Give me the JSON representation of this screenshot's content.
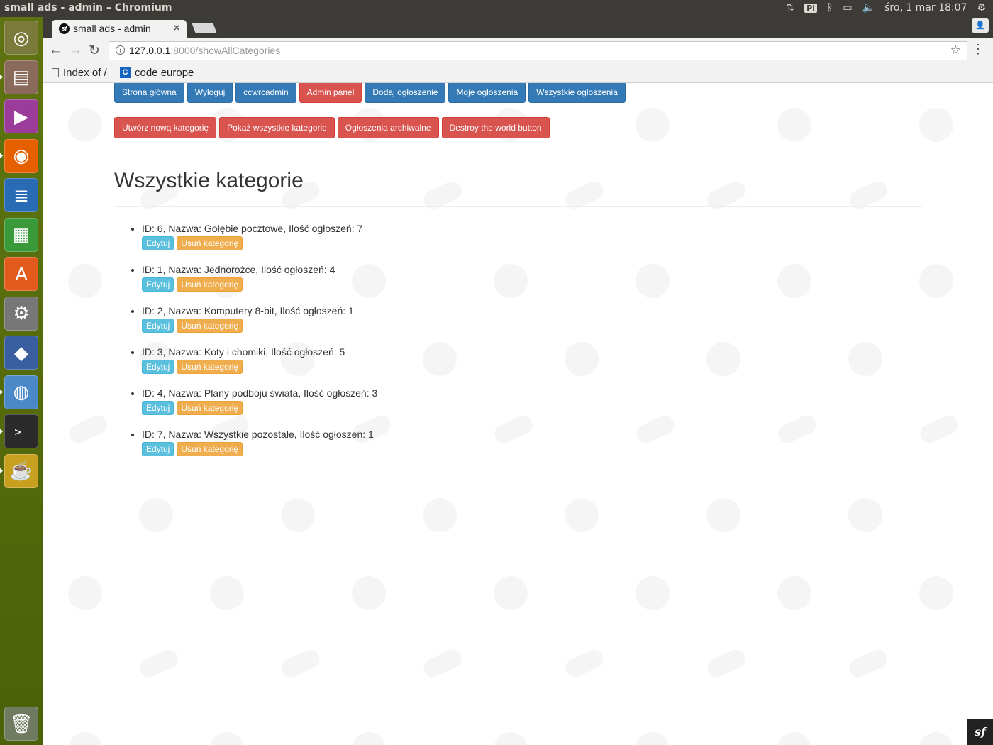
{
  "os": {
    "window_title": "small ads - admin – Chromium",
    "keyboard_layout": "Pl",
    "datetime": "śro, 1 mar 18:07"
  },
  "browser": {
    "tab_title": "small ads - admin",
    "url_host": "127.0.0.1",
    "url_path": ":8000/showAllCategories",
    "bookmarks": [
      {
        "label": "Index of /",
        "icon": "document-icon"
      },
      {
        "label": "code europe",
        "icon": "c-logo-icon"
      }
    ]
  },
  "nav": {
    "main": [
      {
        "label": "Strona główna",
        "style": "primary"
      },
      {
        "label": "Wyloguj",
        "style": "primary"
      },
      {
        "label": "ccwrcadmin",
        "style": "primary"
      },
      {
        "label": "Admin panel",
        "style": "danger"
      },
      {
        "label": "Dodaj ogłoszenie",
        "style": "primary"
      },
      {
        "label": "Moje ogłoszenia",
        "style": "primary"
      },
      {
        "label": "Wszystkie ogłoszenia",
        "style": "primary"
      }
    ],
    "admin": [
      {
        "label": "Utwórz nową kategorię",
        "style": "danger"
      },
      {
        "label": "Pokaż wszystkie kategorie",
        "style": "danger"
      },
      {
        "label": "Ogłoszenia archiwalne",
        "style": "danger"
      },
      {
        "label": "Destroy the world button",
        "style": "danger"
      }
    ]
  },
  "heading": "Wszystkie kategorie",
  "categories": [
    {
      "text": "ID: 6, Nazwa: Gołębie pocztowe, Ilość ogłoszeń: 7",
      "edit": "Edytuj",
      "delete": "Usuń kategorię"
    },
    {
      "text": "ID: 1, Nazwa: Jednorożce, Ilość ogłoszeń: 4",
      "edit": "Edytuj",
      "delete": "Usuń kategorię"
    },
    {
      "text": "ID: 2, Nazwa: Komputery 8-bit, Ilość ogłoszeń: 1",
      "edit": "Edytuj",
      "delete": "Usuń kategorię"
    },
    {
      "text": "ID: 3, Nazwa: Koty i chomiki, Ilość ogłoszeń: 5",
      "edit": "Edytuj",
      "delete": "Usuń kategorię"
    },
    {
      "text": "ID: 4, Nazwa: Plany podboju świata, Ilość ogłoszeń: 3",
      "edit": "Edytuj",
      "delete": "Usuń kategorię"
    },
    {
      "text": "ID: 7, Nazwa: Wszystkie pozostałe, Ilość ogłoszeń: 1",
      "edit": "Edytuj",
      "delete": "Usuń kategorię"
    }
  ],
  "launcher": [
    {
      "icon": "ubuntu-dash-icon",
      "color": "#7a7a3a"
    },
    {
      "icon": "files-icon",
      "color": "#8a6a5a"
    },
    {
      "icon": "video-icon",
      "color": "#9b3c9b"
    },
    {
      "icon": "firefox-icon",
      "color": "#e66000"
    },
    {
      "icon": "writer-icon",
      "color": "#2a6bb5"
    },
    {
      "icon": "calc-icon",
      "color": "#3a9a3a"
    },
    {
      "icon": "software-center-icon",
      "color": "#e25a1c"
    },
    {
      "icon": "settings-icon",
      "color": "#777777"
    },
    {
      "icon": "virtualbox-icon",
      "color": "#3a5fa0"
    },
    {
      "icon": "chromium-icon",
      "color": "#4a88c8"
    },
    {
      "icon": "terminal-icon",
      "color": "#2b2b2b"
    },
    {
      "icon": "teapot-icon",
      "color": "#c8a020"
    }
  ],
  "colors": {
    "primary": "#337ab7",
    "danger": "#d9534f",
    "info": "#5bc0de",
    "warning": "#f0ad4e",
    "launcher": "#5f7410"
  }
}
